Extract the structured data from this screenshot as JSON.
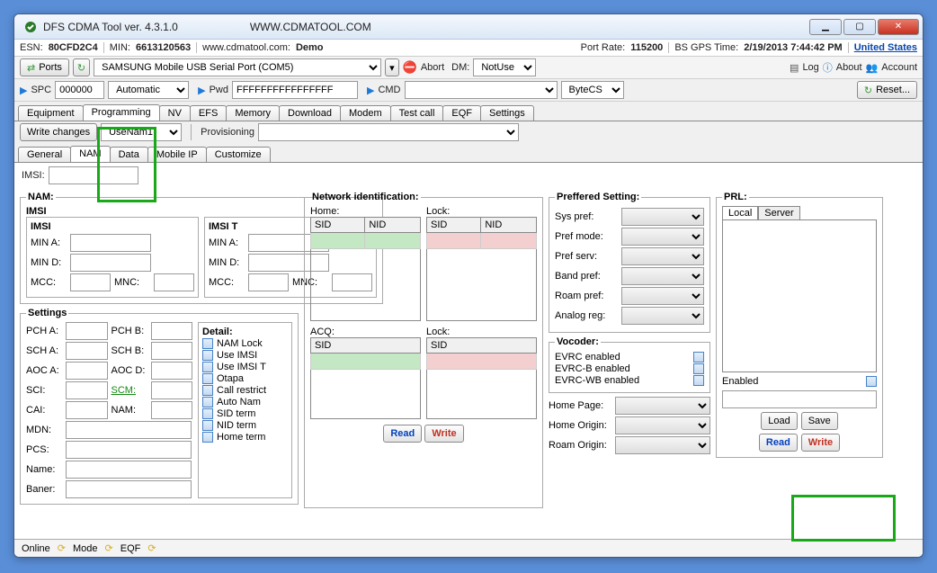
{
  "window": {
    "title": "DFS CDMA Tool ver. 4.3.1.0",
    "url": "WWW.CDMATOOL.COM"
  },
  "info_row": {
    "esn_lbl": "ESN:",
    "esn": "80CFD2C4",
    "min_lbl": "MIN:",
    "min": "6613120563",
    "site": "www.cdmatool.com:",
    "demo": "Demo",
    "port_rate_lbl": "Port Rate:",
    "port_rate": "115200",
    "gps_lbl": "BS GPS Time:",
    "gps": "2/19/2013 7:44:42 PM",
    "country": "United States"
  },
  "ports_row": {
    "ports_btn": "Ports",
    "port_select": "SAMSUNG Mobile USB Serial Port (COM5)",
    "abort": "Abort",
    "dm_lbl": "DM:",
    "dm_val": "NotUse",
    "log": "Log",
    "about": "About",
    "account": "Account"
  },
  "spc_row": {
    "spc_lbl": "SPC",
    "spc_val": "000000",
    "spc_mode": "Automatic",
    "pwd_lbl": "Pwd",
    "pwd_val": "FFFFFFFFFFFFFFFF",
    "cmd_lbl": "CMD",
    "byte": "ByteCS",
    "reset": "Reset..."
  },
  "main_tabs": [
    "Equipment",
    "Programming",
    "NV",
    "EFS",
    "Memory",
    "Download",
    "Modem",
    "Test call",
    "EQF",
    "Settings"
  ],
  "sub_controls": {
    "write_changes": "Write changes",
    "use_nam": "UseNam1",
    "provisioning": "Provisioning"
  },
  "sub_tabs": [
    "General",
    "NAM",
    "Data",
    "Mobile IP",
    "Customize"
  ],
  "imsi_lbl": "IMSI:",
  "nam": {
    "title": "NAM:",
    "imsi_title": "IMSI",
    "group_imsi": "IMSI",
    "group_imsit": "IMSI T",
    "mina": "MIN A:",
    "mind": "MIN D:",
    "mcc": "MCC:",
    "mnc": "MNC:"
  },
  "settings": {
    "title": "Settings",
    "pcha": "PCH A:",
    "pchb": "PCH B:",
    "scha": "SCH A:",
    "schb": "SCH B:",
    "aoca": "AOC A:",
    "aocd": "AOC D:",
    "sci": "SCI:",
    "scm": "SCM:",
    "cai": "CAI:",
    "nam": "NAM:",
    "mdn": "MDN:",
    "pcs": "PCS:",
    "name": "Name:",
    "baner": "Baner:"
  },
  "detail": {
    "title": "Detail:",
    "items": [
      "NAM Lock",
      "Use IMSI",
      "Use IMSI T",
      "Otapa",
      "Call restrict",
      "Auto Nam",
      "SID term",
      "NID term",
      "Home term"
    ]
  },
  "network": {
    "title": "Network identification:",
    "home": "Home:",
    "lock": "Lock:",
    "sid": "SID",
    "nid": "NID",
    "acq": "ACQ:"
  },
  "buttons": {
    "read": "Read",
    "write": "Write",
    "load": "Load",
    "save": "Save"
  },
  "preferred": {
    "title": "Preffered Setting:",
    "sys": "Sys pref:",
    "mode": "Pref mode:",
    "serv": "Pref serv:",
    "band": "Band pref:",
    "roam": "Roam pref:",
    "analog": "Analog reg:"
  },
  "vocoder": {
    "title": "Vocoder:",
    "evrc": "EVRC enabled",
    "evrcb": "EVRC-B enabled",
    "evrcwb": "EVRC-WB enabled"
  },
  "pages": {
    "home_page": "Home Page:",
    "home_origin": "Home Origin:",
    "roam_origin": "Roam Origin:"
  },
  "prl": {
    "title": "PRL:",
    "local": "Local",
    "server": "Server",
    "enabled": "Enabled"
  },
  "status": {
    "online": "Online",
    "mode": "Mode",
    "eqf": "EQF"
  }
}
